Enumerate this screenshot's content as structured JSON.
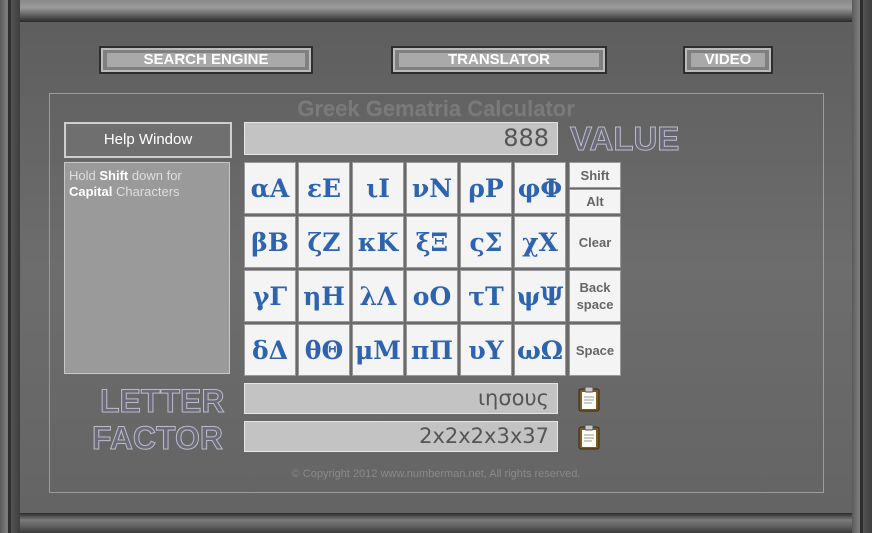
{
  "nav": {
    "search_engine": "SEARCH ENGINE",
    "translator": "TRANSLATOR",
    "video": "VIDEO"
  },
  "title": "Greek Gematria Calculator",
  "help": {
    "button_label": "Help Window",
    "hold": "Hold",
    "shift": "Shift",
    "down_for": "down for",
    "capital": "Capital",
    "characters": "Characters"
  },
  "value": {
    "label": "VALUE",
    "text": "888"
  },
  "letter": {
    "label": "LETTER",
    "text": "ιησους"
  },
  "factor": {
    "label": "FACTOR",
    "text": "2x2x2x3x37"
  },
  "keys": [
    [
      "αΑ",
      "εΕ",
      "ιΙ",
      "νΝ",
      "ρΡ",
      "φΦ"
    ],
    [
      "βΒ",
      "ζΖ",
      "κΚ",
      "ξΞ",
      "ςΣ",
      "χΧ"
    ],
    [
      "γΓ",
      "ηΗ",
      "λΛ",
      "οΟ",
      "τΤ",
      "ψΨ"
    ],
    [
      "δΔ",
      "θΘ",
      "μΜ",
      "πΠ",
      "υΥ",
      "ωΩ"
    ]
  ],
  "function_keys": {
    "shift": "Shift",
    "alt": "Alt",
    "clear": "Clear",
    "back": "Back",
    "space_word": "space",
    "space": "Space"
  },
  "icons": {
    "copy": "clipboard-icon"
  },
  "copyright": "© Copyright 2012 www.numberman.net, All rights reserved."
}
